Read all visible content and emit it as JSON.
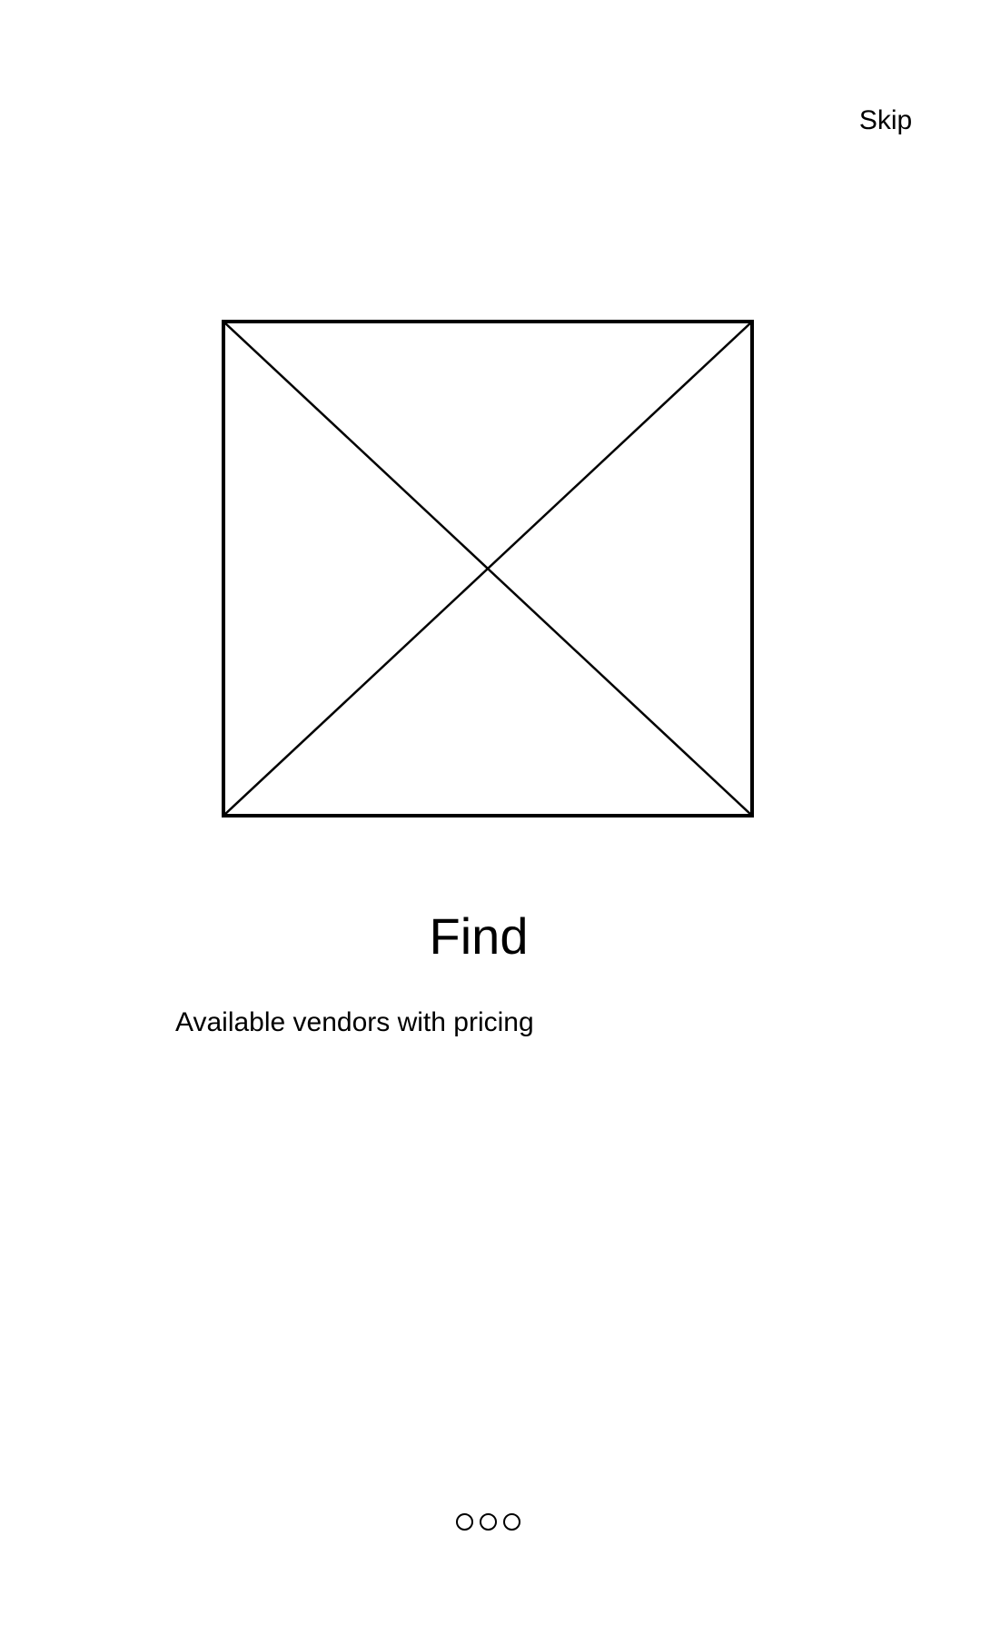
{
  "header": {
    "skip_label": "Skip"
  },
  "onboarding": {
    "title": "Find",
    "subtitle": "Available vendors with pricing"
  },
  "page_indicator": {
    "total": 3,
    "current": 1
  },
  "colors": {
    "foreground": "#000000",
    "background": "#ffffff"
  }
}
